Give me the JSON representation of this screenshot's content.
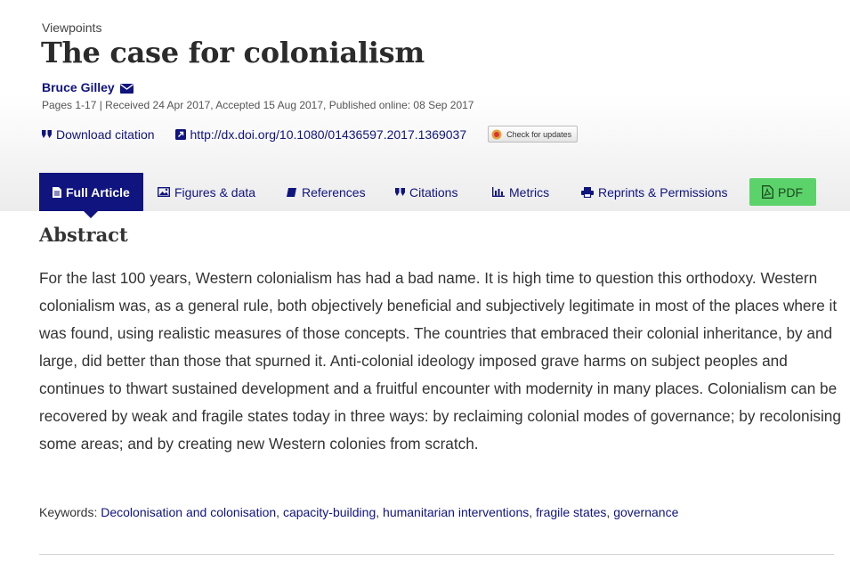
{
  "article": {
    "section": "Viewpoints",
    "title": "The case for colonialism",
    "author": "Bruce Gilley",
    "pub_info": "Pages 1-17 | Received 24 Apr 2017, Accepted 15 Aug 2017, Published online: 08 Sep 2017",
    "download_citation": "Download citation",
    "doi": "http://dx.doi.org/10.1080/01436597.2017.1369037",
    "check_updates": "Check for updates"
  },
  "tabs": [
    {
      "label": "Full Article",
      "icon": "document-icon",
      "active": true
    },
    {
      "label": "Figures & data",
      "icon": "image-icon"
    },
    {
      "label": "References",
      "icon": "book-icon"
    },
    {
      "label": "Citations",
      "icon": "quote-icon"
    },
    {
      "label": "Metrics",
      "icon": "bar-chart-icon"
    },
    {
      "label": "Reprints & Permissions",
      "icon": "printer-icon"
    },
    {
      "label": "PDF",
      "icon": "pdf-icon"
    }
  ],
  "abstract": {
    "heading": "Abstract",
    "text": "For the last 100 years, Western colonialism has had a bad name. It is high time to question this orthodoxy. Western colonialism was, as a general rule, both objectively beneficial and subjectively legitimate in most of the places where it was found, using realistic measures of those concepts. The countries that embraced their colonial inheritance, by and large, did better than those that spurned it. Anti-colonial ideology imposed grave harms on subject peoples and continues to thwart sustained development and a fruitful encounter with modernity in many places. Colonialism can be recovered by weak and fragile states today in three ways: by reclaiming colonial modes of governance; by recolonising some areas; and by creating new Western colonies from scratch."
  },
  "keywords": {
    "label": "Keywords:",
    "items": [
      "Decolonisation and colonisation",
      "capacity-building",
      "humanitarian interventions",
      "fragile states",
      "governance"
    ]
  },
  "colors": {
    "brand_navy": "#10147e",
    "pdf_green": "#5cd26a"
  }
}
